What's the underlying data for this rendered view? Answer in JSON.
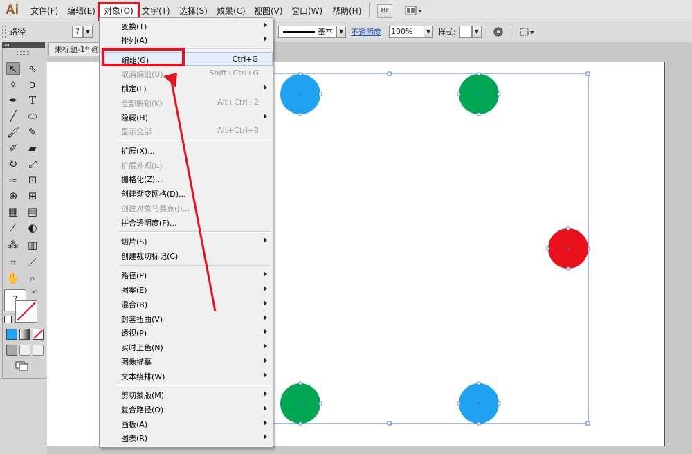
{
  "app": {
    "logo": "Ai"
  },
  "menubar": [
    {
      "label": "文件(F)"
    },
    {
      "label": "编辑(E)"
    },
    {
      "label": "对象(O)"
    },
    {
      "label": "文字(T)"
    },
    {
      "label": "选择(S)"
    },
    {
      "label": "效果(C)"
    },
    {
      "label": "视图(V)"
    },
    {
      "label": "窗口(W)"
    },
    {
      "label": "帮助(H)"
    }
  ],
  "menubar_buttons": {
    "bridge": "Br"
  },
  "controlbar": {
    "selection_label": "路径",
    "stroke_question": "?",
    "brush_label": "基本",
    "opacity_label": "不透明度",
    "opacity_value": "100%",
    "style_label": "样式:"
  },
  "document": {
    "tab_title": "未标题-1* @"
  },
  "tools": {
    "unknown_fill": "?"
  },
  "object_menu": [
    {
      "label": "变换(T)",
      "shortcut": "",
      "submenu": true,
      "disabled": false
    },
    {
      "label": "排列(A)",
      "shortcut": "",
      "submenu": true,
      "disabled": false
    },
    {
      "label": "编组(G)",
      "shortcut": "Ctrl+G",
      "submenu": false,
      "disabled": false
    },
    {
      "label": "取消编组(U)",
      "shortcut": "Shift+Ctrl+G",
      "submenu": false,
      "disabled": true
    },
    {
      "label": "锁定(L)",
      "shortcut": "",
      "submenu": true,
      "disabled": false
    },
    {
      "label": "全部解锁(K)",
      "shortcut": "Alt+Ctrl+2",
      "submenu": false,
      "disabled": true
    },
    {
      "label": "隐藏(H)",
      "shortcut": "",
      "submenu": true,
      "disabled": false
    },
    {
      "label": "显示全部",
      "shortcut": "Alt+Ctrl+3",
      "submenu": false,
      "disabled": true
    },
    {
      "label": "扩展(X)...",
      "shortcut": "",
      "submenu": false,
      "disabled": false
    },
    {
      "label": "扩展外观(E)",
      "shortcut": "",
      "submenu": false,
      "disabled": true
    },
    {
      "label": "栅格化(Z)...",
      "shortcut": "",
      "submenu": false,
      "disabled": false
    },
    {
      "label": "创建渐变网格(D)...",
      "shortcut": "",
      "submenu": false,
      "disabled": false
    },
    {
      "label": "创建对象马赛克(J)...",
      "shortcut": "",
      "submenu": false,
      "disabled": true
    },
    {
      "label": "拼合透明度(F)...",
      "shortcut": "",
      "submenu": false,
      "disabled": false
    },
    {
      "label": "切片(S)",
      "shortcut": "",
      "submenu": true,
      "disabled": false
    },
    {
      "label": "创建裁切标记(C)",
      "shortcut": "",
      "submenu": false,
      "disabled": false
    },
    {
      "label": "路径(P)",
      "shortcut": "",
      "submenu": true,
      "disabled": false
    },
    {
      "label": "图案(E)",
      "shortcut": "",
      "submenu": true,
      "disabled": false
    },
    {
      "label": "混合(B)",
      "shortcut": "",
      "submenu": true,
      "disabled": false
    },
    {
      "label": "封套扭曲(V)",
      "shortcut": "",
      "submenu": true,
      "disabled": false
    },
    {
      "label": "透视(P)",
      "shortcut": "",
      "submenu": true,
      "disabled": false
    },
    {
      "label": "实时上色(N)",
      "shortcut": "",
      "submenu": true,
      "disabled": false
    },
    {
      "label": "图像描摹",
      "shortcut": "",
      "submenu": true,
      "disabled": false
    },
    {
      "label": "文本绕排(W)",
      "shortcut": "",
      "submenu": true,
      "disabled": false
    },
    {
      "label": "剪切蒙版(M)",
      "shortcut": "",
      "submenu": true,
      "disabled": false
    },
    {
      "label": "复合路径(O)",
      "shortcut": "",
      "submenu": true,
      "disabled": false
    },
    {
      "label": "画板(A)",
      "shortcut": "",
      "submenu": true,
      "disabled": false
    },
    {
      "label": "图表(R)",
      "shortcut": "",
      "submenu": true,
      "disabled": false
    }
  ],
  "circle_colors": {
    "blue": "#1fa2f0",
    "green": "#00a651",
    "red": "#e8101a"
  },
  "highlight_color": "#e8101a",
  "selection_color": "#4d70e0"
}
